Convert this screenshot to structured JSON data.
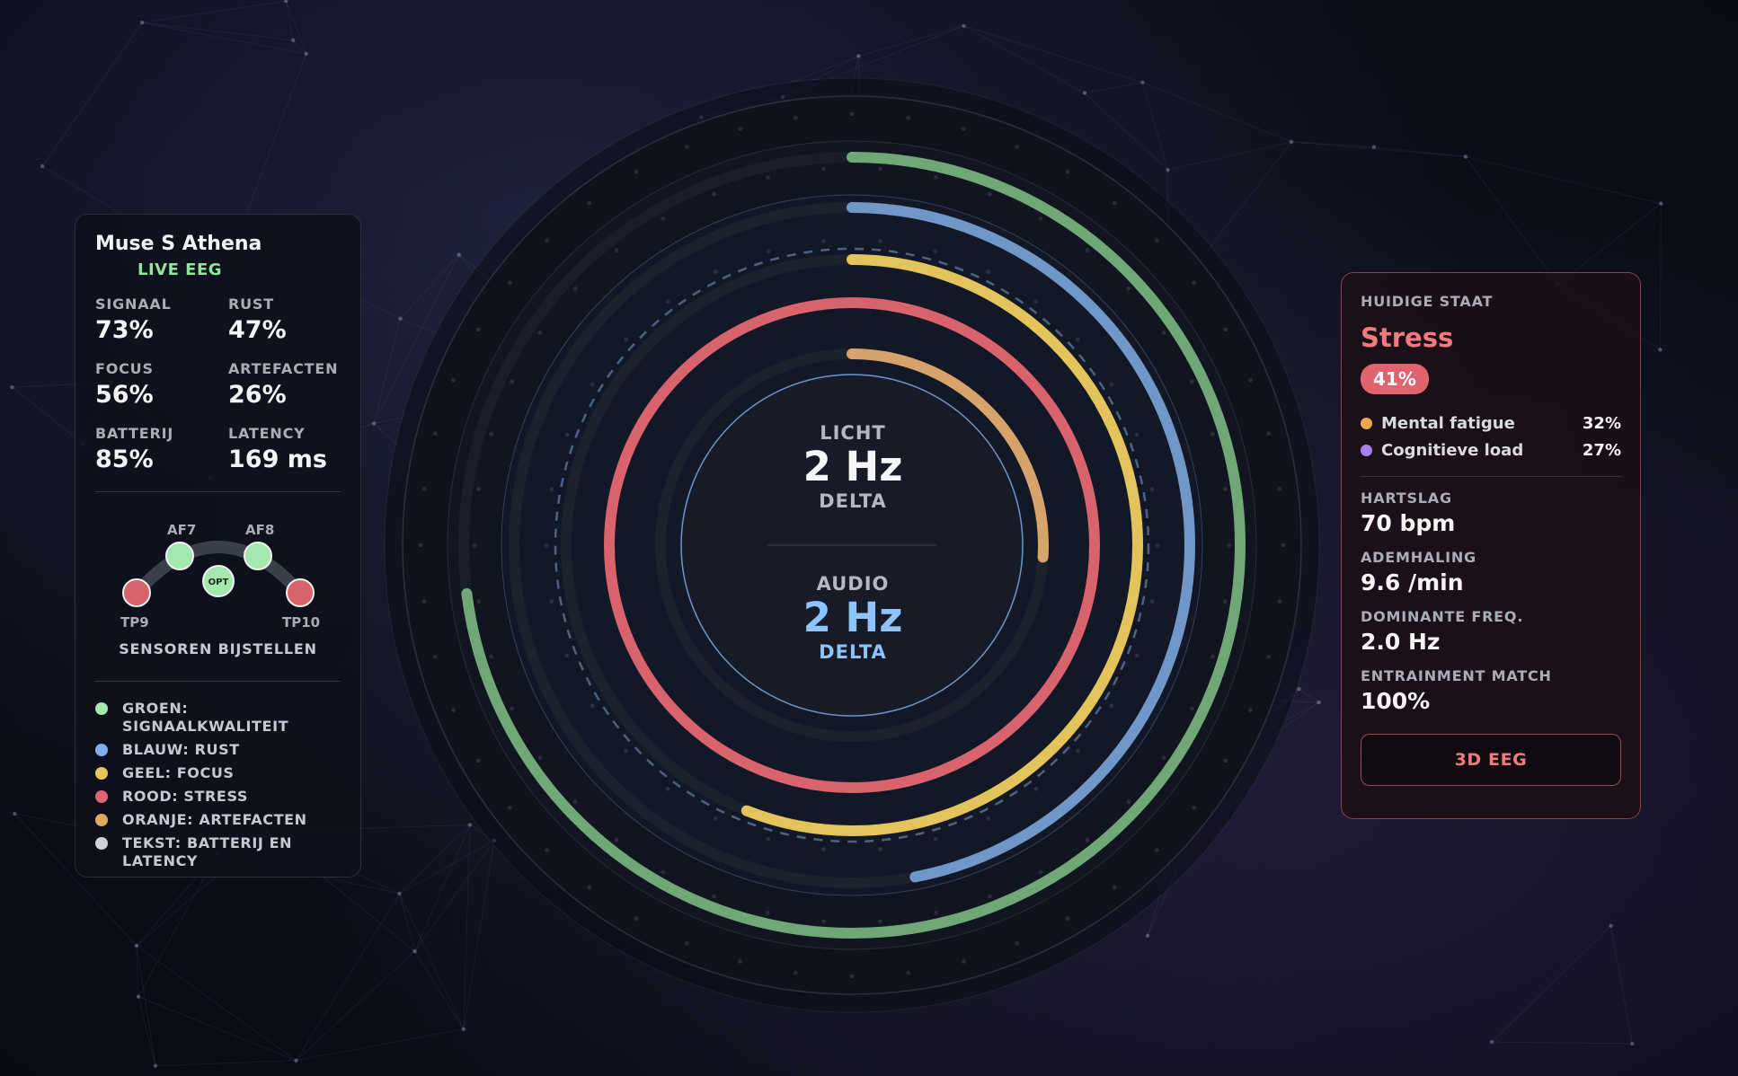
{
  "device": {
    "name": "Muse S Athena",
    "status": "LIVE EEG",
    "stats": [
      {
        "label": "SIGNAAL",
        "value": "73%"
      },
      {
        "label": "RUST",
        "value": "47%"
      },
      {
        "label": "FOCUS",
        "value": "56%"
      },
      {
        "label": "ARTEFACTEN",
        "value": "26%"
      },
      {
        "label": "BATTERIJ",
        "value": "85%"
      },
      {
        "label": "LATENCY",
        "value": "169 ms"
      }
    ],
    "sensors": {
      "af7": "AF7",
      "af8": "AF8",
      "tp9": "TP9",
      "tp10": "TP10",
      "opt": "OPT",
      "adjust_label": "SENSOREN BIJSTELLEN"
    },
    "legend": [
      {
        "label": "GROEN: SIGNAALKWALITEIT",
        "color": "#a5e8ad"
      },
      {
        "label": "BLAUW: RUST",
        "color": "#7fb0ea"
      },
      {
        "label": "GEEL: FOCUS",
        "color": "#e7c55a"
      },
      {
        "label": "ROOD: STRESS",
        "color": "#e06470"
      },
      {
        "label": "ORANJE: ARTEFACTEN",
        "color": "#e0a860"
      },
      {
        "label": "TEKST: BATTERIJ EN LATENCY",
        "color": "#cfd2da"
      }
    ]
  },
  "center": {
    "light_label": "LICHT",
    "light_freq": "2 Hz",
    "light_band": "DELTA",
    "audio_label": "AUDIO",
    "audio_freq": "2 Hz",
    "audio_band": "DELTA"
  },
  "rings": [
    {
      "name": "signal",
      "color": "#6fa777",
      "value": 0.73
    },
    {
      "name": "rest",
      "color": "#6f97c8",
      "value": 0.47
    },
    {
      "name": "focus",
      "color": "#e3c35b",
      "value": 0.56
    },
    {
      "name": "stress",
      "color": "#d8636c",
      "value": 1.0
    },
    {
      "name": "artifacts",
      "color": "#d6a46a",
      "value": 0.26
    }
  ],
  "state": {
    "label": "HUIDIGE STAAT",
    "name": "Stress",
    "percent": "41%",
    "factors": [
      {
        "name": "Mental fatigue",
        "value": "32%",
        "color": "#e9a94c"
      },
      {
        "name": "Cognitieve load",
        "value": "27%",
        "color": "#a97ff0"
      }
    ],
    "metrics": [
      {
        "label": "HARTSLAG",
        "value": "70 bpm"
      },
      {
        "label": "ADEMHALING",
        "value": "9.6 /min"
      },
      {
        "label": "DOMINANTE FREQ.",
        "value": "2.0 Hz"
      },
      {
        "label": "ENTRAINMENT MATCH",
        "value": "100%"
      }
    ],
    "button_label": "3D EEG"
  }
}
